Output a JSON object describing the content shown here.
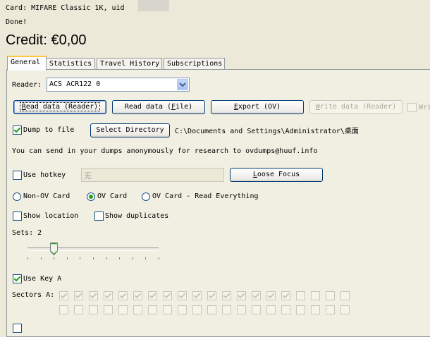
{
  "status": {
    "card_line": "Card: MIFARE Classic 1K, uid",
    "done_line": "Done!"
  },
  "credit": "Credit: €0,00",
  "tabs": [
    {
      "label": "General",
      "active": true
    },
    {
      "label": "Statistics",
      "active": false
    },
    {
      "label": "Travel History",
      "active": false
    },
    {
      "label": "Subscriptions",
      "active": false
    }
  ],
  "reader": {
    "label": "Reader:",
    "selected": "ACS ACR122 0"
  },
  "buttons": {
    "read_reader": {
      "pre": "R",
      "rest": "ead data (Reader)"
    },
    "read_file": {
      "pre": "Read data (",
      "u": "F",
      "post": "ile)"
    },
    "export": {
      "pre": "",
      "u": "E",
      "post": "xport (OV)"
    },
    "write_reader": {
      "pre": "",
      "u": "W",
      "post": "rite data (Reader)"
    },
    "write_cut": "Wri",
    "select_directory": "Select Directory",
    "loose_focus": {
      "pre": "",
      "u": "L",
      "post": "oose Focus"
    }
  },
  "dump": {
    "label": "Dump to file",
    "checked": true,
    "directory": "C:\\Documents and Settings\\Administrator\\桌面"
  },
  "info_text": "You can send in your dumps anonymously for research to ovdumps@huuf.info",
  "hotkey": {
    "label": "Use hotkey",
    "checked": false,
    "value": "无"
  },
  "card_mode": {
    "options": [
      "Non-OV Card",
      "OV Card",
      "OV Card - Read Everything"
    ],
    "selected": 1
  },
  "show_location": {
    "label": "Show location",
    "checked": false
  },
  "show_duplicates": {
    "label": "Show duplicates",
    "checked": false
  },
  "sets": {
    "label": "Sets: 2",
    "value": 2,
    "max": 10
  },
  "use_key_a": {
    "label": "Use Key A",
    "checked": true
  },
  "sectors": {
    "label": "Sectors A:",
    "row1_checked": [
      true,
      true,
      true,
      true,
      true,
      true,
      true,
      true,
      true,
      true,
      true,
      true,
      true,
      true,
      true,
      true,
      false,
      false,
      false,
      false
    ],
    "row2_checked": [
      false,
      false,
      false,
      false,
      false,
      false,
      false,
      false,
      false,
      false,
      false,
      false,
      false,
      false,
      false,
      false,
      false,
      false,
      false,
      false
    ]
  }
}
